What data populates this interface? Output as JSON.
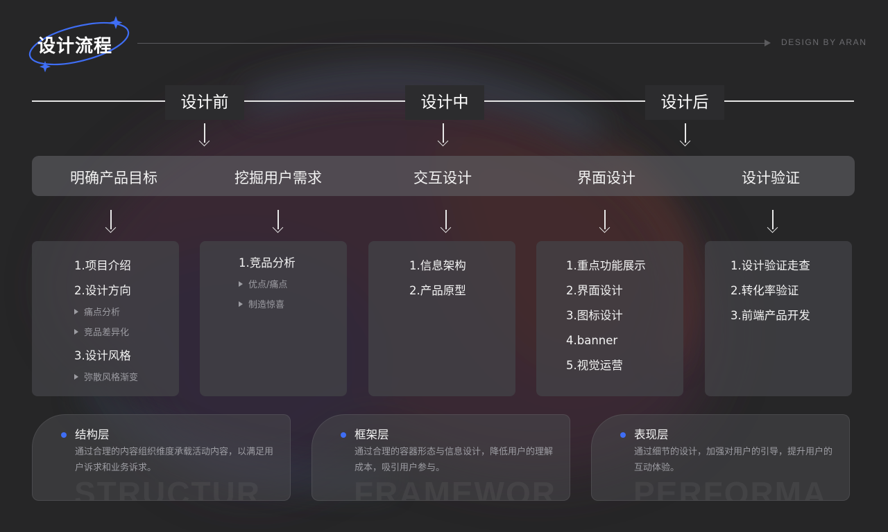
{
  "header": {
    "title": "设计流程",
    "credit": "DESIGN BY ARAN"
  },
  "colors": {
    "background": "#262627",
    "accent_blue": "#3f6ef5",
    "card": "#444448"
  },
  "phases": [
    "设计前",
    "设计中",
    "设计后"
  ],
  "stages": [
    {
      "label": "明确产品目标",
      "items": [
        {
          "text": "1.项目介绍",
          "level": 1
        },
        {
          "text": "2.设计方向",
          "level": 1
        },
        {
          "text": "痛点分析",
          "level": 2
        },
        {
          "text": "竞品差异化",
          "level": 2
        },
        {
          "text": "3.设计风格",
          "level": 1
        },
        {
          "text": "弥散风格渐变",
          "level": 2
        }
      ]
    },
    {
      "label": "挖掘用户需求",
      "items": [
        {
          "text": "1.竞品分析",
          "level": 1
        },
        {
          "text": "优点/痛点",
          "level": 2
        },
        {
          "text": "制造惊喜",
          "level": 2
        }
      ]
    },
    {
      "label": "交互设计",
      "items": [
        {
          "text": "1.信息架构",
          "level": 1
        },
        {
          "text": "2.产品原型",
          "level": 1
        }
      ]
    },
    {
      "label": "界面设计",
      "items": [
        {
          "text": "1.重点功能展示",
          "level": 1
        },
        {
          "text": "2.界面设计",
          "level": 1
        },
        {
          "text": "3.图标设计",
          "level": 1
        },
        {
          "text": "4.banner",
          "level": 1
        },
        {
          "text": "5.视觉运营",
          "level": 1
        }
      ]
    },
    {
      "label": "设计验证",
      "items": [
        {
          "text": "1.设计验证走查",
          "level": 1
        },
        {
          "text": "2.转化率验证",
          "level": 1
        },
        {
          "text": "3.前端产品开发",
          "level": 1
        }
      ]
    }
  ],
  "layers": [
    {
      "title": "结构层",
      "description": "通过合理的内容组织维度承载活动内容，以满足用户诉求和业务诉求。",
      "watermark": "STRUCTUR"
    },
    {
      "title": "框架层",
      "description": "通过合理的容器形态与信息设计，降低用户的理解成本，吸引用户参与。",
      "watermark": "FRAMEWOR"
    },
    {
      "title": "表现层",
      "description": "通过细节的设计，加强对用户的引导，提升用户的互动体验。",
      "watermark": "PERFORMA"
    }
  ]
}
